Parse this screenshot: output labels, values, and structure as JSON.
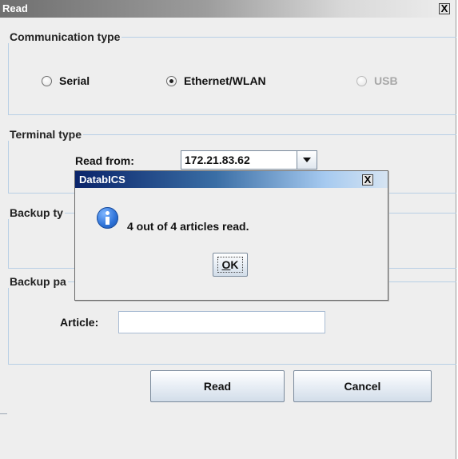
{
  "read_window": {
    "title": "Read",
    "close_label": "X",
    "communication": {
      "legend": "Communication type",
      "options": [
        {
          "label": "Serial",
          "checked": false,
          "enabled": true
        },
        {
          "label": "Ethernet/WLAN",
          "checked": true,
          "enabled": true
        },
        {
          "label": "USB",
          "checked": false,
          "enabled": false
        }
      ]
    },
    "terminal": {
      "legend": "Terminal type",
      "read_from_label": "Read from:",
      "read_from_value": "172.21.83.62"
    },
    "backup_type": {
      "legend_visible": "Backup ty"
    },
    "backup_params": {
      "legend_visible": "Backup pa",
      "article_label": "Article:",
      "article_value": ""
    },
    "read_button": "Read",
    "cancel_button": "Cancel"
  },
  "message_dialog": {
    "title": "DatabICS",
    "close_label": "X",
    "message": "4 out of 4 articles read.",
    "icon": "info-icon",
    "ok_mnemonic": "O",
    "ok_rest": "K"
  },
  "colors": {
    "window_bg": "#eeeeee",
    "group_border": "#b8cfe5",
    "dialog_title_start": "#0a246a",
    "dialog_title_end": "#a6caf0"
  }
}
